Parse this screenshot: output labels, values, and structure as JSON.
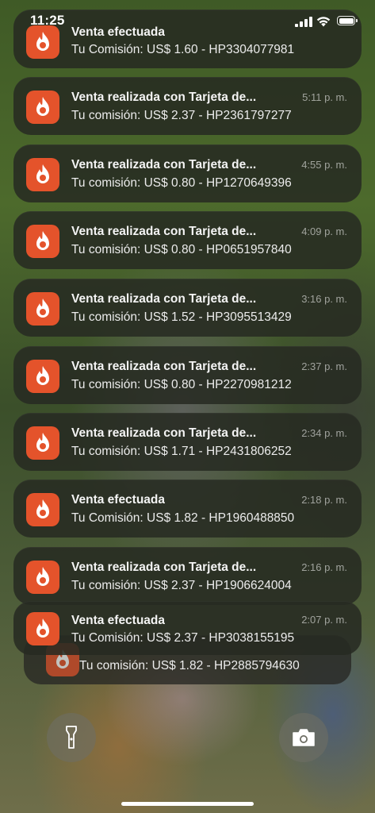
{
  "status_bar": {
    "time": "11:25",
    "signal_icon": "cellular-signal-icon",
    "wifi_icon": "wifi-icon",
    "battery_icon": "battery-icon"
  },
  "app": {
    "icon": "hotmart-flame-icon",
    "color": "#e4532b"
  },
  "notifications": [
    {
      "title": "Venta efectuada",
      "body": "Tu Comisión: US$ 1.60 - HP3304077981",
      "time": ""
    },
    {
      "title": "Venta realizada con Tarjeta de...",
      "body": "Tu comisión: US$ 2.37 - HP2361797277",
      "time": "5:11 p. m."
    },
    {
      "title": "Venta realizada con Tarjeta de...",
      "body": "Tu comisión: US$ 0.80 - HP1270649396",
      "time": "4:55 p. m."
    },
    {
      "title": "Venta realizada con Tarjeta de...",
      "body": "Tu comisión: US$ 0.80 - HP0651957840",
      "time": "4:09 p. m."
    },
    {
      "title": "Venta realizada con Tarjeta de...",
      "body": "Tu comisión: US$ 1.52 - HP3095513429",
      "time": "3:16 p. m."
    },
    {
      "title": "Venta realizada con Tarjeta de...",
      "body": "Tu comisión: US$ 0.80 - HP2270981212",
      "time": "2:37 p. m."
    },
    {
      "title": "Venta realizada con Tarjeta de...",
      "body": "Tu comisión: US$ 1.71 - HP2431806252",
      "time": "2:34 p. m."
    },
    {
      "title": "Venta efectuada",
      "body": "Tu Comisión: US$ 1.82 - HP1960488850",
      "time": "2:18 p. m."
    },
    {
      "title": "Venta realizada con Tarjeta de...",
      "body": "Tu comisión: US$ 2.37 - HP1906624004",
      "time": "2:16 p. m."
    },
    {
      "title": "Venta efectuada",
      "body": "Tu Comisión: US$ 2.37 - HP3038155195",
      "time": "2:07 p. m."
    }
  ],
  "stacked_notification": {
    "body": "Tu comisión: US$ 1.82 - HP2885794630"
  },
  "controls": {
    "flashlight_icon": "flashlight-icon",
    "camera_icon": "camera-icon"
  }
}
